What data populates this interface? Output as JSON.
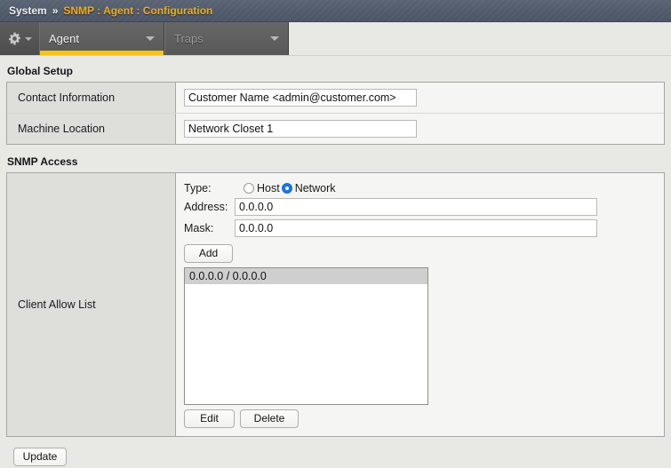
{
  "header": {
    "breadcrumb_root": "System",
    "breadcrumb_separator": "»",
    "breadcrumb_current": "SNMP : Agent : Configuration",
    "accent_color": "#f3ab18",
    "bar_color": "#525c6c"
  },
  "toolbar": {
    "gear_icon": "gear-icon",
    "gear_caret_icon": "chevron-down-icon",
    "tabs": [
      {
        "label": "Agent",
        "active": true,
        "caret_icon": "chevron-down-icon"
      },
      {
        "label": "Traps",
        "active": false,
        "caret_icon": "chevron-down-icon"
      }
    ],
    "active_underline_color": "#f5c418"
  },
  "global_setup": {
    "title": "Global Setup",
    "rows": [
      {
        "label": "Contact Information",
        "value": "Customer Name <admin@customer.com>",
        "placeholder": ""
      },
      {
        "label": "Machine Location",
        "value": "Network Closet 1",
        "placeholder": ""
      }
    ]
  },
  "snmp_access": {
    "title": "SNMP Access",
    "row_label": "Client Allow List",
    "type_label": "Type:",
    "type_options": [
      {
        "label": "Host",
        "selected": false
      },
      {
        "label": "Network",
        "selected": true
      }
    ],
    "selected_radio_color": "#1a73e8",
    "address_label": "Address:",
    "address_value": "0.0.0.0",
    "mask_label": "Mask:",
    "mask_value": "0.0.0.0",
    "add_label": "Add",
    "allow_list": [
      {
        "text": "0.0.0.0 / 0.0.0.0",
        "selected": true
      }
    ],
    "edit_label": "Edit",
    "delete_label": "Delete"
  },
  "footer": {
    "update_label": "Update"
  }
}
